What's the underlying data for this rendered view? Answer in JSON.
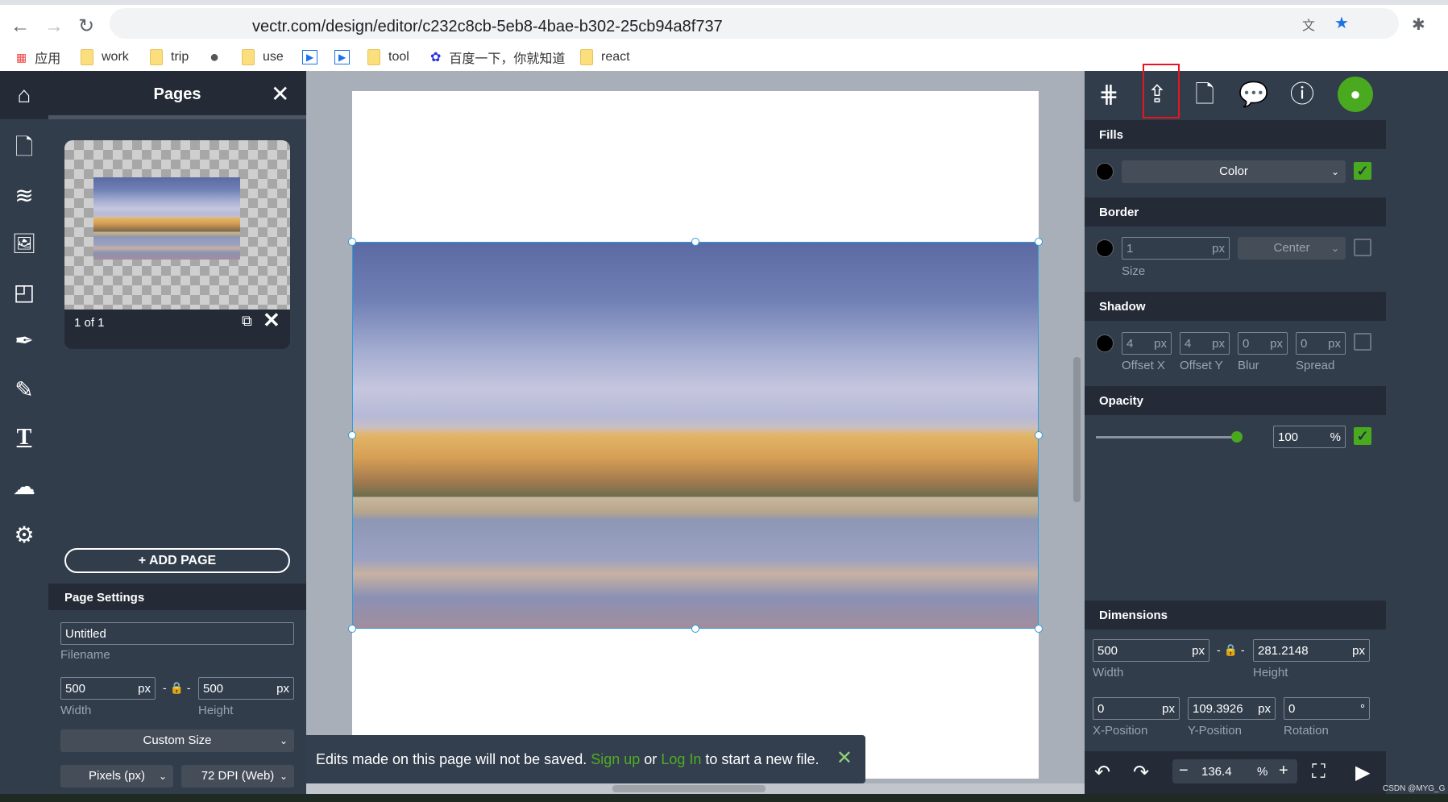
{
  "browser": {
    "url": "vectr.com/design/editor/c232c8cb-5eb8-4bae-b302-25cb94a8f737",
    "bookmarks": [
      {
        "label": "应用",
        "icon": "apps-grid-icon"
      },
      {
        "label": "work",
        "icon": "folder-icon"
      },
      {
        "label": "trip",
        "icon": "folder-icon"
      },
      {
        "label": "",
        "icon": "globe-icon"
      },
      {
        "label": "use",
        "icon": "folder-icon"
      },
      {
        "label": "",
        "icon": "play-icon"
      },
      {
        "label": "",
        "icon": "play-icon"
      },
      {
        "label": "tool",
        "icon": "folder-icon"
      },
      {
        "label": "百度一下，你就知道",
        "icon": "baidu-icon"
      },
      {
        "label": "react",
        "icon": "folder-icon"
      }
    ]
  },
  "rail": {
    "items": [
      "home",
      "page-settings",
      "layers",
      "image-search",
      "shapes",
      "pen",
      "pencil",
      "text",
      "upload",
      "settings"
    ]
  },
  "pages_panel": {
    "title": "Pages",
    "page_counter": "1 of 1",
    "add_page": "+ ADD PAGE",
    "settings_title": "Page Settings",
    "filename": "Untitled",
    "filename_label": "Filename",
    "width": "500",
    "height": "500",
    "unit": "px",
    "width_label": "Width",
    "height_label": "Height",
    "size_preset": "Custom Size",
    "units": "Pixels (px)",
    "dpi": "72 DPI (Web)"
  },
  "toast": {
    "text1": "Edits made on this page will not be saved.",
    "signup": "Sign up",
    "or": "or",
    "login": "Log In",
    "text2": "to start a new file."
  },
  "right_panel": {
    "top_icons": [
      "snap-icon",
      "upload-export-icon",
      "new-page-icon",
      "comments-icon",
      "info-icon",
      "user-avatar-icon"
    ],
    "highlighted_icon": "upload-export-icon",
    "fills": {
      "title": "Fills",
      "type": "Color",
      "enabled": true
    },
    "border": {
      "title": "Border",
      "size": "1",
      "unit": "px",
      "size_label": "Size",
      "position": "Center",
      "enabled": false
    },
    "shadow": {
      "title": "Shadow",
      "offset_x": "4",
      "offset_y": "4",
      "blur": "0",
      "spread": "0",
      "unit": "px",
      "labels": [
        "Offset X",
        "Offset Y",
        "Blur",
        "Spread"
      ],
      "enabled": false
    },
    "opacity": {
      "title": "Opacity",
      "value": "100",
      "unit": "%",
      "enabled": true,
      "level": 1.0
    },
    "dimensions": {
      "title": "Dimensions",
      "width": "500",
      "height": "281.2148",
      "x": "0",
      "y": "109.3926",
      "rotation": "0",
      "unit": "px",
      "deg": "°",
      "width_label": "Width",
      "height_label": "Height",
      "x_label": "X-Position",
      "y_label": "Y-Position",
      "rotation_label": "Rotation"
    },
    "zoom": {
      "value": "136.4",
      "unit": "%"
    }
  },
  "watermark": "CSDN @MYG_G",
  "colors": {
    "accent": "#4aaa1f",
    "panel": "#323d4c",
    "panel_dark": "#242b37",
    "selection": "#2d9cdb",
    "highlight_box": "#e8141e"
  }
}
